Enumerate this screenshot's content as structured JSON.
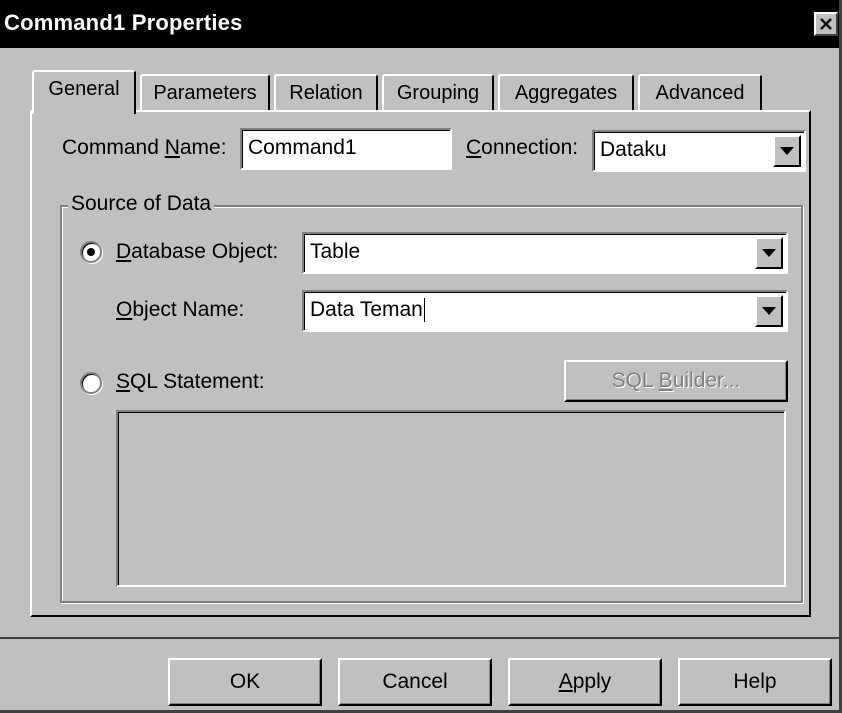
{
  "window": {
    "title": "Command1 Properties",
    "close_glyph": "✕"
  },
  "tabs": [
    {
      "label": "General",
      "active": true
    },
    {
      "label": "Parameters",
      "active": false
    },
    {
      "label": "Relation",
      "active": false
    },
    {
      "label": "Grouping",
      "active": false
    },
    {
      "label": "Aggregates",
      "active": false
    },
    {
      "label": "Advanced",
      "active": false
    }
  ],
  "general": {
    "command_name_label_pre": "Command ",
    "command_name_label_u": "N",
    "command_name_label_post": "ame:",
    "command_name_value": "Command1",
    "connection_label_u": "C",
    "connection_label_post": "onnection:",
    "connection_value": "Dataku",
    "source_group_title": "Source of Data",
    "db_object_label_u": "D",
    "db_object_label_post": "atabase Object:",
    "db_object_value": "Table",
    "db_object_selected": true,
    "object_name_label_u": "O",
    "object_name_label_post": "bject Name:",
    "object_name_value": "Data Teman",
    "sql_label_u": "S",
    "sql_label_post": "QL Statement:",
    "sql_selected": false,
    "sql_builder_label_pre": "SQL ",
    "sql_builder_label_u": "B",
    "sql_builder_label_post": "uilder...",
    "sql_text": ""
  },
  "footer": {
    "ok_label": "OK",
    "cancel_label": "Cancel",
    "apply_label_u": "A",
    "apply_label_post": "pply",
    "help_label": "Help"
  }
}
